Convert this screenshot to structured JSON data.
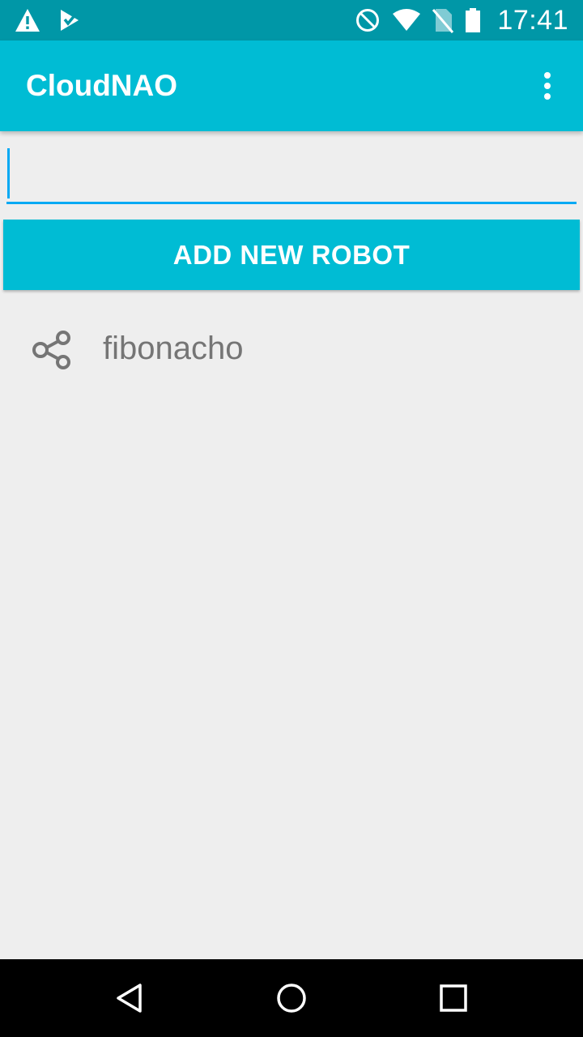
{
  "status_bar": {
    "time": "17:41",
    "left_icons": [
      "warning-icon",
      "checklist-icon"
    ],
    "right_icons": [
      "do-not-disturb-icon",
      "wifi-icon",
      "no-sim-icon",
      "battery-icon"
    ]
  },
  "app_bar": {
    "title": "CloudNAO",
    "overflow_icon": "more-vert-icon"
  },
  "input": {
    "value": "",
    "placeholder": ""
  },
  "add_button": {
    "label": "ADD NEW ROBOT"
  },
  "robots": [
    {
      "name": "fibonacho",
      "icon": "share-icon"
    }
  ],
  "nav_bar": {
    "buttons": [
      "back-icon",
      "home-icon",
      "recents-icon"
    ]
  },
  "colors": {
    "status_bar": "#0097A7",
    "primary": "#00BCD4",
    "accent": "#03A9F4",
    "background": "#EEEEEE",
    "list_text": "#757575"
  }
}
